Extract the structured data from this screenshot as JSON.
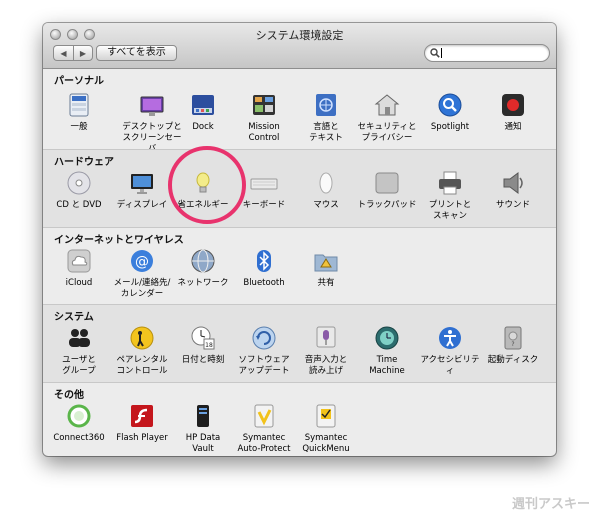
{
  "window": {
    "title": "システム環境設定"
  },
  "toolbar": {
    "back": "◀",
    "forward": "▶",
    "show_all": "すべてを表示"
  },
  "sections": [
    {
      "title": "パーソナル",
      "items": [
        "一般",
        "デスクトップと\nスクリーンセーバ",
        "Dock",
        "Mission\nControl",
        "言語と\nテキスト",
        "セキュリティと\nプライバシー",
        "Spotlight",
        "通知"
      ]
    },
    {
      "title": "ハードウェア",
      "items": [
        "CD と DVD",
        "ディスプレイ",
        "省エネルギー",
        "キーボード",
        "マウス",
        "トラックパッド",
        "プリントと\nスキャン",
        "サウンド"
      ]
    },
    {
      "title": "インターネットとワイヤレス",
      "items": [
        "iCloud",
        "メール/連絡先/\nカレンダー",
        "ネットワーク",
        "Bluetooth",
        "共有"
      ]
    },
    {
      "title": "システム",
      "items": [
        "ユーザと\nグループ",
        "ペアレンタル\nコントロール",
        "日付と時刻",
        "ソフトウェア\nアップデート",
        "音声入力と\n読み上げ",
        "Time\nMachine",
        "アクセシビリティ",
        "起動ディスク"
      ]
    },
    {
      "title": "その他",
      "items": [
        "Connect360",
        "Flash Player",
        "HP Data\nVault",
        "Symantec\nAuto-Protect",
        "Symantec\nQuickMenu"
      ]
    }
  ],
  "watermark": "週刊アスキー"
}
